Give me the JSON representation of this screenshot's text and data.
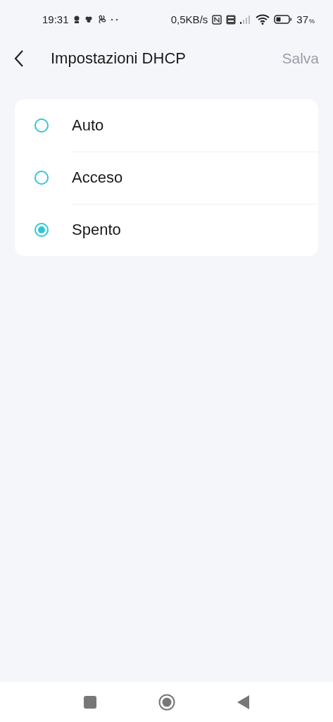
{
  "status_bar": {
    "time": "19:31",
    "speed": "0,5KB/s",
    "battery_percent": "37",
    "battery_unit": "%"
  },
  "header": {
    "title": "Impostazioni DHCP",
    "action": "Salva",
    "action_disabled": true
  },
  "options": [
    {
      "label": "Auto",
      "selected": false
    },
    {
      "label": "Acceso",
      "selected": false
    },
    {
      "label": "Spento",
      "selected": true
    }
  ]
}
